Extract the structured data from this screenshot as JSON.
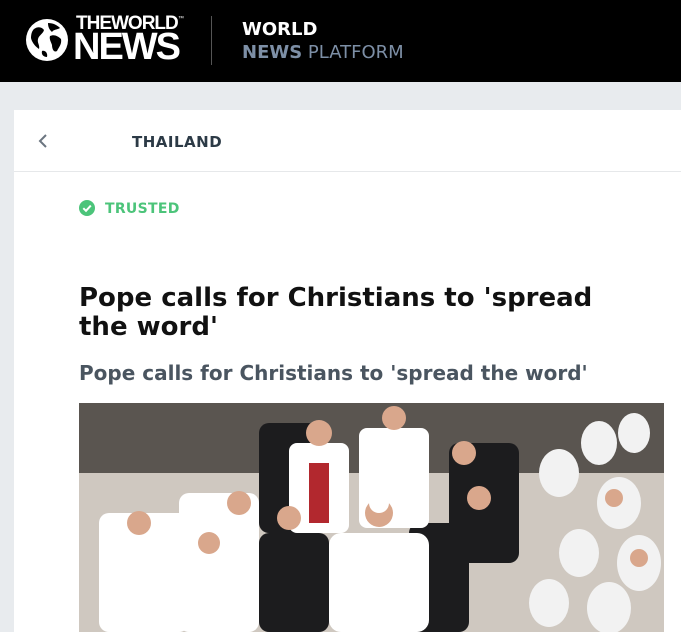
{
  "header": {
    "logo_line1": "THEWORLD",
    "logo_line2": "NEWS",
    "logo_tm": "™",
    "platform_line1": "WORLD",
    "platform_line2_bold": "NEWS",
    "platform_line2_light": "PLATFORM"
  },
  "subnav": {
    "back_icon": "chevron-left-icon",
    "section_label": "THAILAND"
  },
  "article": {
    "badge_icon": "check-circle-icon",
    "badge_label": "TRUSTED",
    "badge_color": "#4cc47a",
    "headline": "Pope calls for Christians to 'spread the word'",
    "subheadline": "Pope calls for Christians to 'spread the word'"
  },
  "colors": {
    "topbar": "#000000",
    "page_bg": "#e8ebee",
    "accent_blue_gray": "#7d8fa6"
  }
}
